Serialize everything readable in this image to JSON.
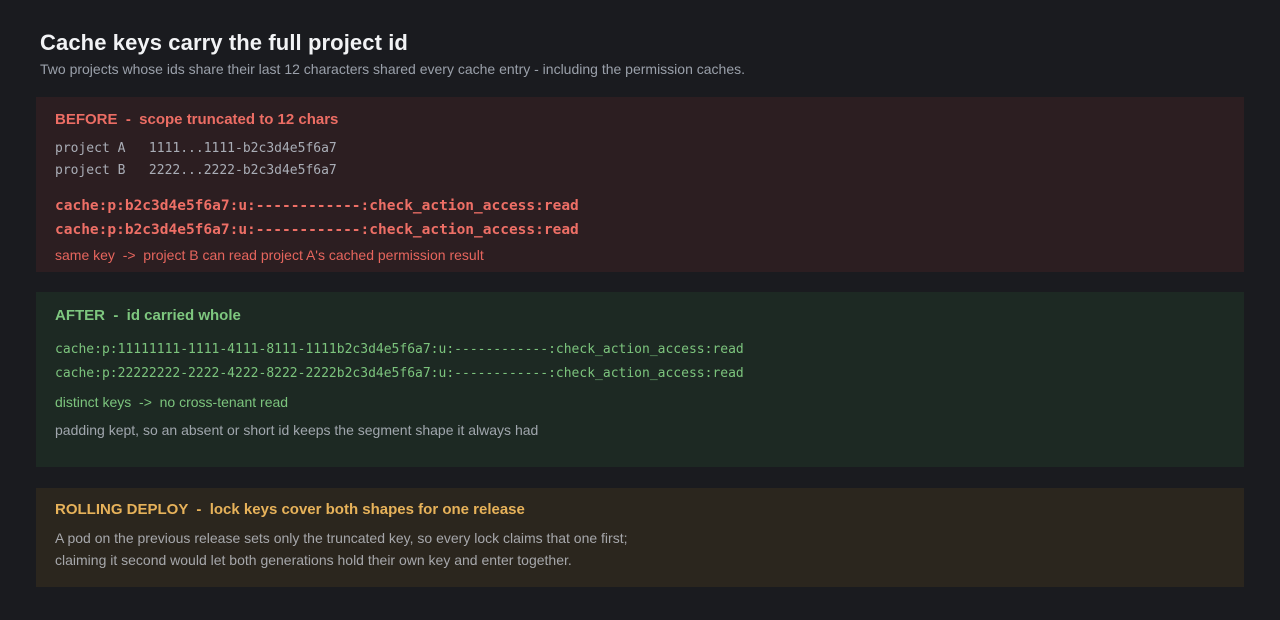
{
  "header": {
    "title": "Cache keys carry the full project id",
    "subtitle": "Two projects whose ids share their last 12 characters shared every cache entry - including the permission caches."
  },
  "before": {
    "heading": "BEFORE  -  scope truncated to 12 chars",
    "project_a": "project A   1111...1111-b2c3d4e5f6a7",
    "project_b": "project B   2222...2222-b2c3d4e5f6a7",
    "key_a": "cache:p:b2c3d4e5f6a7:u:------------:check_action_access:read",
    "key_b": "cache:p:b2c3d4e5f6a7:u:------------:check_action_access:read",
    "note": "same key  ->  project B can read project A's cached permission result"
  },
  "after": {
    "heading": "AFTER  -  id carried whole",
    "key_a": "cache:p:11111111-1111-4111-8111-1111b2c3d4e5f6a7:u:------------:check_action_access:read",
    "key_b": "cache:p:22222222-2222-4222-8222-2222b2c3d4e5f6a7:u:------------:check_action_access:read",
    "note": "distinct keys  ->  no cross-tenant read",
    "padding_note": "padding kept, so an absent or short id keeps the segment shape it always had"
  },
  "rolling": {
    "heading": "ROLLING DEPLOY  -  lock keys cover both shapes for one release",
    "line1": "A pod on the previous release sets only the truncated key, so every lock claims that one first;",
    "line2": "claiming it second would let both generations hold their own key and enter together."
  },
  "colors": {
    "background": "#1a1b1f",
    "before_panel": "#2c1e21",
    "before_accent": "#ec6d64",
    "after_panel": "#1d2923",
    "after_accent": "#7cc47d",
    "rolling_panel": "#2b261e",
    "rolling_accent": "#e7b25a"
  }
}
